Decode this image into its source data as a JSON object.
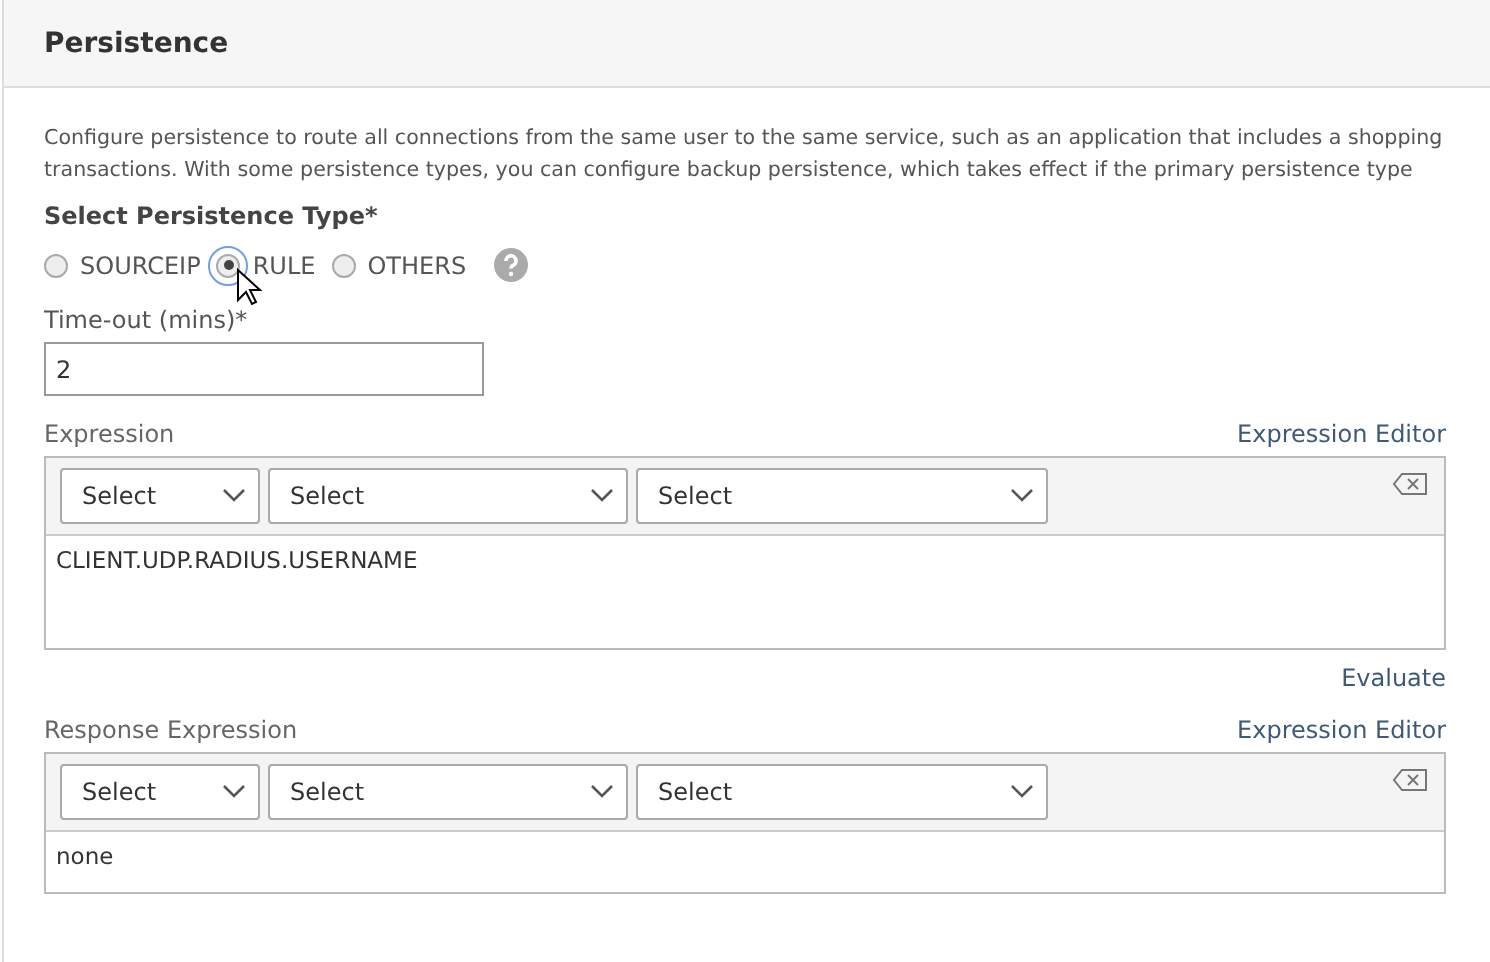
{
  "panel": {
    "title": "Persistence"
  },
  "description": [
    "Configure persistence to route all connections from the same user to the same service, such as an application that includes a shopping",
    "transactions. With some persistence types, you can configure backup persistence, which takes effect if the primary persistence type"
  ],
  "persistence_type": {
    "label": "Select Persistence Type*",
    "options": [
      {
        "label": "SOURCEIP",
        "selected": false
      },
      {
        "label": "RULE",
        "selected": true
      },
      {
        "label": "OTHERS",
        "selected": false
      }
    ]
  },
  "timeout": {
    "label": "Time-out (mins)*",
    "value": "2"
  },
  "expressions": [
    {
      "label": "Expression",
      "editor_link": "Expression Editor",
      "selects": [
        "Select",
        "Select",
        "Select"
      ],
      "value": "CLIENT.UDP.RADIUS.USERNAME",
      "action_link": "Evaluate"
    },
    {
      "label": "Response Expression",
      "editor_link": "Expression Editor",
      "selects": [
        "Select",
        "Select",
        "Select"
      ],
      "value": "none"
    }
  ]
}
